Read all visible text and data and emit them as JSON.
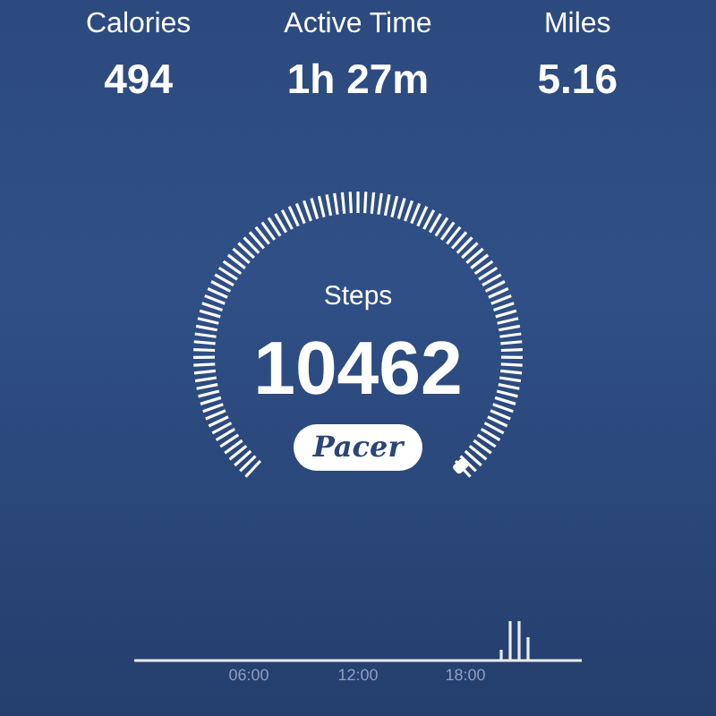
{
  "stats": [
    {
      "label": "Calories",
      "value": "494"
    },
    {
      "label": "Active Time",
      "value": "1h 27m"
    },
    {
      "label": "Miles",
      "value": "5.16"
    }
  ],
  "gauge": {
    "label": "Steps",
    "value": "10462"
  },
  "logo": "Pacer",
  "activity_chart": {
    "axis_labels": [
      "06:00",
      "12:00",
      "18:00"
    ]
  }
}
